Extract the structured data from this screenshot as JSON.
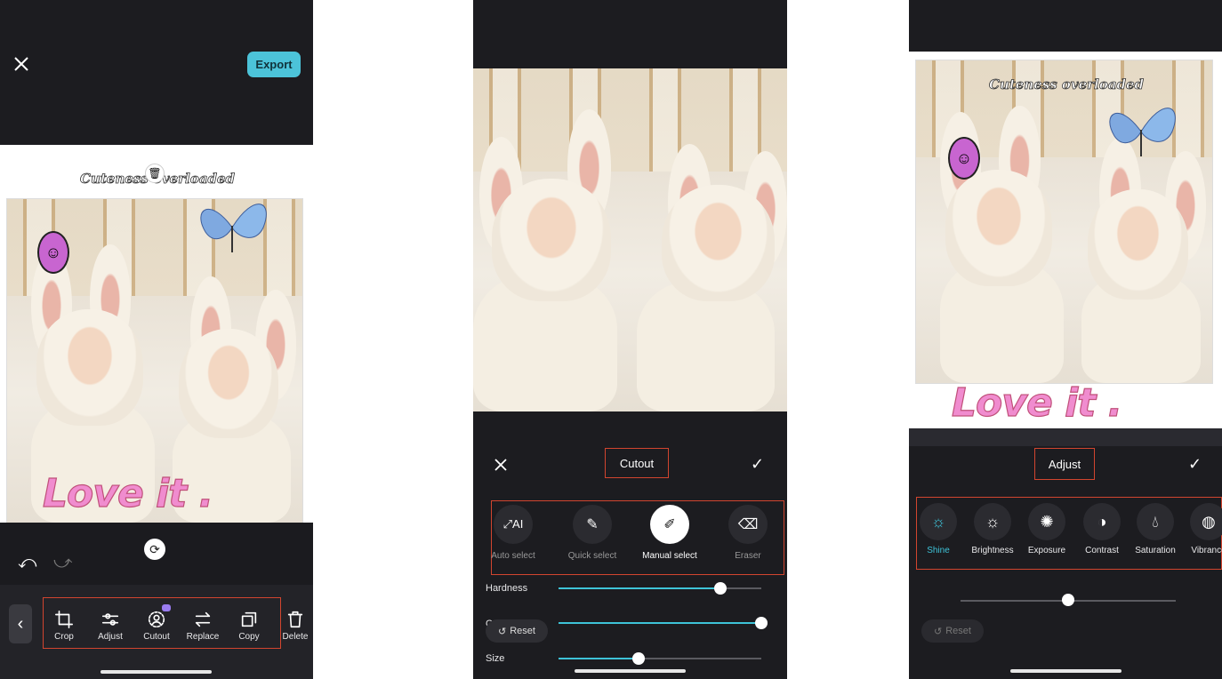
{
  "screen1": {
    "export_label": "Export",
    "sticker_text": "Cuteness overloaded",
    "love_text": "Love it .",
    "toolbar": [
      {
        "label": "Crop",
        "icon": "crop-icon"
      },
      {
        "label": "Adjust",
        "icon": "adjust-icon"
      },
      {
        "label": "Cutout",
        "icon": "cutout-icon"
      },
      {
        "label": "Replace",
        "icon": "replace-icon"
      },
      {
        "label": "Copy",
        "icon": "copy-icon"
      },
      {
        "label": "Delete",
        "icon": "delete-icon"
      }
    ]
  },
  "screen2": {
    "title": "Cutout",
    "tools": [
      {
        "label": "Auto select",
        "icon": "auto-select-icon"
      },
      {
        "label": "Quick select",
        "icon": "quick-select-icon"
      },
      {
        "label": "Manual select",
        "icon": "manual-select-icon",
        "active": true
      },
      {
        "label": "Eraser",
        "icon": "eraser-icon"
      }
    ],
    "sliders": [
      {
        "label": "Hardness",
        "value": 0.7
      },
      {
        "label": "O",
        "value": 1.0
      },
      {
        "label": "Size",
        "value": 0.35
      }
    ],
    "reset_label": "Reset"
  },
  "screen3": {
    "title": "Adjust",
    "sticker_text": "Cuteness overloaded",
    "love_text": "Love it .",
    "tools": [
      {
        "label": "Shine",
        "icon": "shine-icon",
        "active": true
      },
      {
        "label": "Brightness",
        "icon": "brightness-icon"
      },
      {
        "label": "Exposure",
        "icon": "exposure-icon"
      },
      {
        "label": "Contrast",
        "icon": "contrast-icon"
      },
      {
        "label": "Saturation",
        "icon": "saturation-icon"
      },
      {
        "label": "Vibrance",
        "icon": "vibrance-icon"
      }
    ],
    "slider_value": 0.5,
    "reset_label": "Reset"
  },
  "colors": {
    "accent": "#3ec3d8",
    "highlight_box": "#d2452f",
    "panel": "#1c1c20",
    "export_button": "#4cc3d9"
  }
}
